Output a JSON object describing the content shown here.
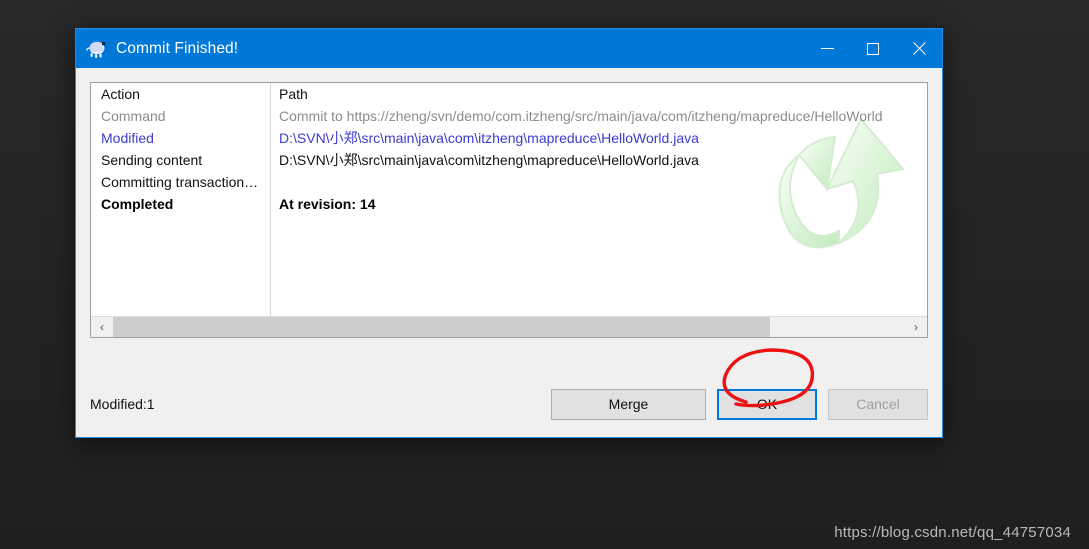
{
  "window": {
    "title": "Commit Finished!",
    "icon": "tortoise-svn-icon",
    "accent_color": "#0078d7",
    "controls": {
      "minimize": "—",
      "maximize": "□",
      "close": "✕"
    }
  },
  "list": {
    "columns": [
      "Action",
      "Path"
    ],
    "rows": [
      {
        "action": "Command",
        "path": "Commit to https://zheng/svn/demo/com.itzheng/src/main/java/com/itzheng/mapreduce/HelloWorld",
        "style": "gray"
      },
      {
        "action": "Modified",
        "path": "D:\\SVN\\小郑\\src\\main\\java\\com\\itzheng\\mapreduce\\HelloWorld.java",
        "style": "blue"
      },
      {
        "action": "Sending content",
        "path": "D:\\SVN\\小郑\\src\\main\\java\\com\\itzheng\\mapreduce\\HelloWorld.java",
        "style": "black"
      },
      {
        "action": "Committing transaction…",
        "path": "",
        "style": "black"
      },
      {
        "action": "Completed",
        "path": "At revision: 14",
        "style": "bold"
      }
    ],
    "watermark_icon": "green-commit-arrow-icon"
  },
  "scrollbar": {
    "left_arrow": "‹",
    "right_arrow": "›",
    "thumb_width_pct": 83
  },
  "footer": {
    "status": "Modified:1",
    "buttons": [
      {
        "label": "Merge",
        "state": "normal"
      },
      {
        "label": "OK",
        "state": "focused"
      },
      {
        "label": "Cancel",
        "state": "disabled"
      }
    ]
  },
  "annotation": {
    "type": "red-ellipse-highlight",
    "color": "#ee1111",
    "target": "OK"
  },
  "page": {
    "watermark": "https://blog.csdn.net/qq_44757034"
  }
}
